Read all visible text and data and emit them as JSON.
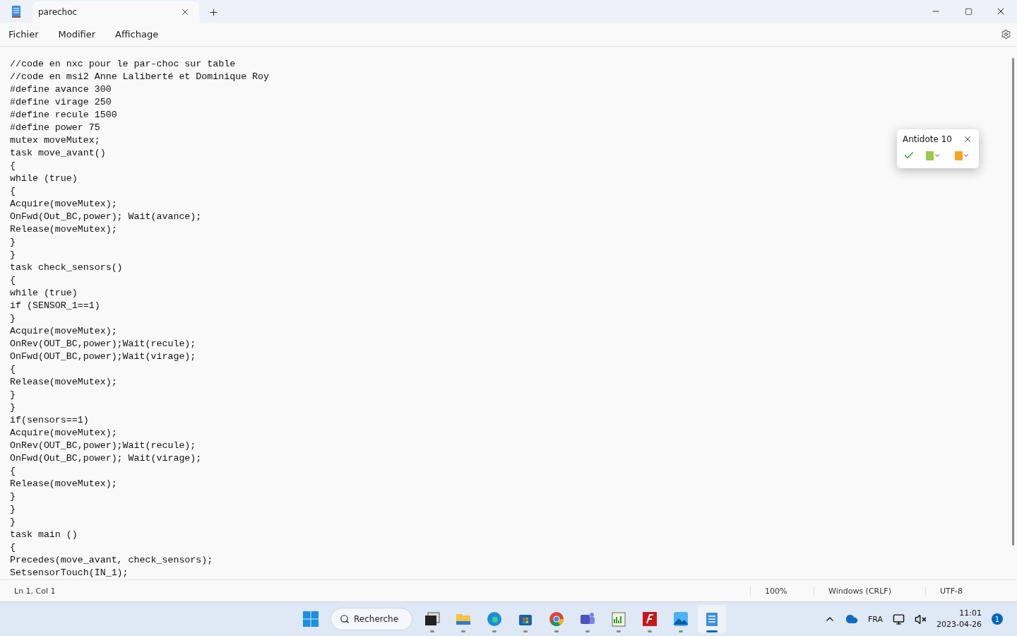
{
  "window": {
    "tab_title": "parechoc",
    "tab_selected": true
  },
  "menu": [
    "Fichier",
    "Modifier",
    "Affichage"
  ],
  "editor": {
    "lines": [
      "//code en nxc pour le par-choc sur table",
      "//code en msi2 Anne Laliberté et Dominique Roy",
      "#define avance 300",
      "#define virage 250",
      "#define recule 1500",
      "#define power 75",
      "mutex moveMutex;",
      "task move_avant()",
      "{",
      "while (true)",
      "{",
      "Acquire(moveMutex);",
      "OnFwd(Out_BC,power); Wait(avance);",
      "Release(moveMutex);",
      "}",
      "}",
      "task check_sensors()",
      "{",
      "while (true)",
      "if (SENSOR_1==1)",
      "}",
      "Acquire(moveMutex);",
      "OnRev(OUT_BC,power);Wait(recule);",
      "OnFwd(OUT_BC,power);Wait(virage);",
      "{",
      "Release(moveMutex);",
      "}",
      "}",
      "if(sensors==1)",
      "Acquire(moveMutex);",
      "OnRev(OUT_BC,power);Wait(recule);",
      "OnFwd(Out_BC,power); Wait(virage);",
      "{",
      "Release(moveMutex);",
      "}",
      "}",
      "}",
      "task main ()",
      "{",
      "Precedes(move_avant, check_sensors);",
      "SetsensorTouch(IN_1);"
    ]
  },
  "antidote": {
    "title": "Antidote 10"
  },
  "status_bar": {
    "position": "Ln 1, Col 1",
    "zoom": "100%",
    "line_ending": "Windows (CRLF)",
    "encoding": "UTF-8"
  },
  "taskbar": {
    "search": "Recherche",
    "apps": [
      {
        "kind": "start",
        "selected": false
      },
      {
        "kind": "desktop",
        "selected": false
      },
      {
        "kind": "folder",
        "selected": false
      },
      {
        "kind": "browser",
        "selected": false
      },
      {
        "kind": "store",
        "selected": false
      },
      {
        "kind": "chrome",
        "selected": false
      },
      {
        "kind": "teams",
        "selected": false
      },
      {
        "kind": "chart",
        "selected": false
      },
      {
        "kind": "ftp",
        "selected": false
      },
      {
        "kind": "photos",
        "selected": false
      },
      {
        "kind": "notepad",
        "selected": true
      }
    ],
    "language": "FRA",
    "time": "11:01",
    "date": "2023-04-26",
    "notifications": "1"
  }
}
